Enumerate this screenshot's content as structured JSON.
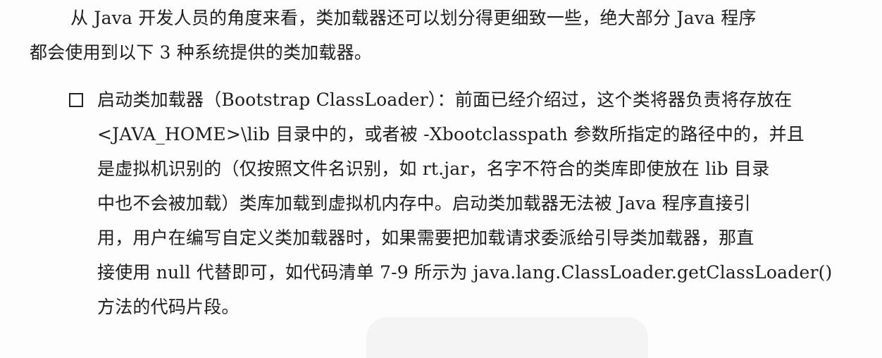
{
  "intro": {
    "line1": "从 Java 开发人员的角度来看，类加载器还可以划分得更细致一些，绝大部分 Java 程序",
    "line2": "都会使用到以下 3 种系统提供的类加载器。"
  },
  "bullet": {
    "icon": "checkbox-bullet-icon",
    "lines": [
      "启动类加载器（Bootstrap ClassLoader）：前面已经介绍过，这个类将器负责将存放在",
      "<JAVA_HOME>\\lib 目录中的，或者被 -Xbootclasspath 参数所指定的路径中的，并且",
      "是虚拟机识别的（仅按照文件名识别，如 rt.jar，名字不符合的类库即使放在 lib 目录",
      "中也不会被加载）类库加载到虚拟机内存中。启动类加载器无法被 Java 程序直接引",
      "用，用户在编写自定义类加载器时，如果需要把加载请求委派给引导类加载器，那直",
      "接使用 null 代替即可，如代码清单 7-9 所示为 java.lang.ClassLoader.getClassLoader()",
      "方法的代码片段。"
    ]
  }
}
